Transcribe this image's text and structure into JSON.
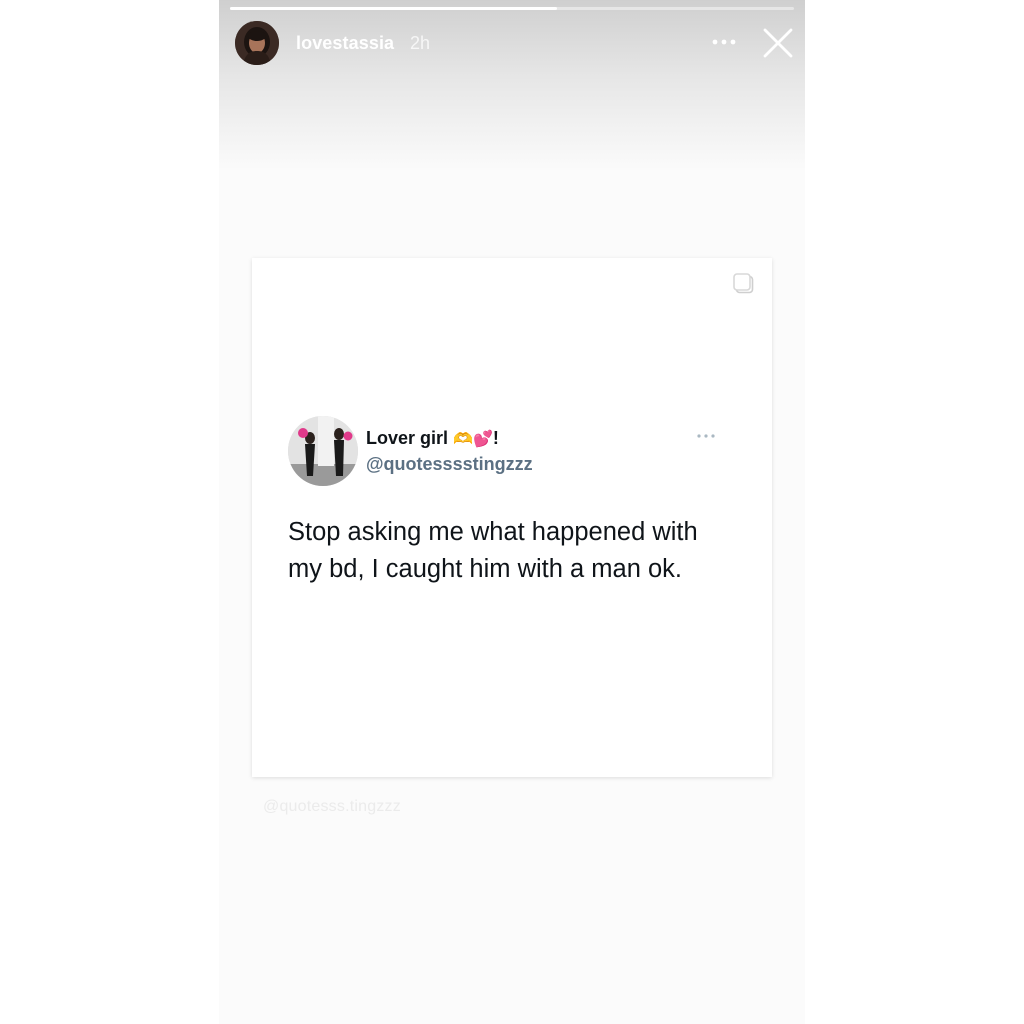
{
  "story": {
    "username": "lovestassia",
    "time_ago": "2h",
    "progress_fraction": 0.58,
    "avatar_icon": "profile-photo-avatar",
    "more_icon": "more-horizontal-icon",
    "close_icon": "close-icon"
  },
  "post": {
    "multi_image_icon": "carousel-icon",
    "tweet": {
      "display_name": "Lover girl",
      "name_emoji": "🫶💕",
      "name_suffix": "!",
      "handle": "@quotesssstingzzz",
      "text": "Stop asking me what happened with my bd, I caught him with a man ok.",
      "avatar_icon": "profile-photo-avatar",
      "more_icon": "more-horizontal-icon"
    }
  },
  "watermark": "@quotesss.tingzzz",
  "colors": {
    "tweet_text": "#0f1419",
    "handle": "#5b7083",
    "header_text": "#ffffff"
  }
}
